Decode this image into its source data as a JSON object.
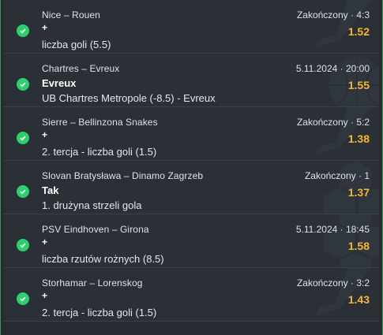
{
  "colors": {
    "background": "#262b31",
    "row": "#2b3036",
    "accent_green": "#2fcf6f",
    "odds_yellow": "#f5b731",
    "border_green": "#3a9a5c"
  },
  "bets": [
    {
      "match": "Nice – Rouen",
      "selection": "+",
      "market": "liczba goli (5.5)",
      "status": "Zakończony · 4:3",
      "odds": "1.52",
      "icon": "check-icon"
    },
    {
      "match": "Chartres – Evreux",
      "selection": "Evreux",
      "market": "UB Chartres Metropole (-8.5) - Evreux",
      "status": "5.11.2024 · 20:00",
      "odds": "1.55",
      "icon": "check-icon"
    },
    {
      "match": "Sierre – Bellinzona Snakes",
      "selection": "+",
      "market": "2. tercja - liczba goli (1.5)",
      "status": "Zakończony · 5:2",
      "odds": "1.38",
      "icon": "check-icon"
    },
    {
      "match": "Slovan Bratysława – Dinamo Zagrzeb",
      "selection": "Tak",
      "market": "1. drużyna strzeli gola",
      "status": "Zakończony · 1",
      "odds": "1.37",
      "icon": "check-icon"
    },
    {
      "match": "PSV Eindhoven – Girona",
      "selection": "+",
      "market": "liczba rzutów rożnych (8.5)",
      "status": "5.11.2024 · 18:45",
      "odds": "1.58",
      "icon": "check-icon"
    },
    {
      "match": "Storhamar – Lorenskog",
      "selection": "+",
      "market": "2. tercja - liczba goli (1.5)",
      "status": "Zakończony · 3:2",
      "odds": "1.43",
      "icon": "check-icon"
    }
  ]
}
